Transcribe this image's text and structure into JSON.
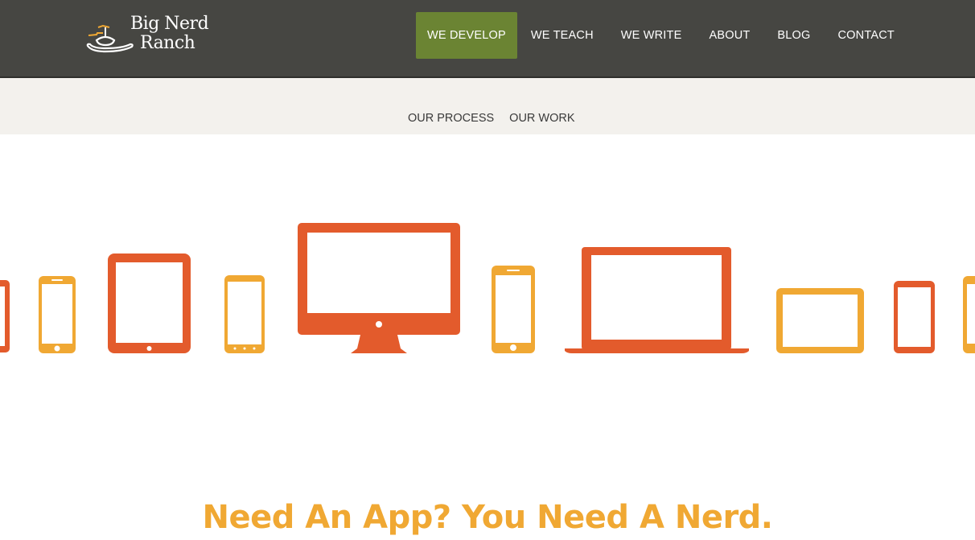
{
  "brand": {
    "name_line1": "Big Nerd",
    "name_line2": "Ranch",
    "logo_icon": "cowboy-hat-propeller-icon"
  },
  "nav": {
    "items": [
      {
        "label": "We Develop",
        "active": true
      },
      {
        "label": "We Teach",
        "active": false
      },
      {
        "label": "We Write",
        "active": false
      },
      {
        "label": "About",
        "active": false
      },
      {
        "label": "Blog",
        "active": false
      },
      {
        "label": "Contact",
        "active": false
      }
    ]
  },
  "subnav": {
    "items": [
      {
        "label": "Our Process"
      },
      {
        "label": "Our Work"
      }
    ]
  },
  "hero": {
    "devices": [
      "phone",
      "phone",
      "tablet",
      "phone",
      "desktop-monitor",
      "phone",
      "laptop",
      "tablet-landscape",
      "phone",
      "phone"
    ]
  },
  "headline": "Need An App? You Need A Nerd.",
  "colors": {
    "header_bg": "#464642",
    "nav_active": "#6b8433",
    "subbar_bg": "#f3f1ed",
    "orange": "#e35b2c",
    "yellow": "#f0a833"
  }
}
